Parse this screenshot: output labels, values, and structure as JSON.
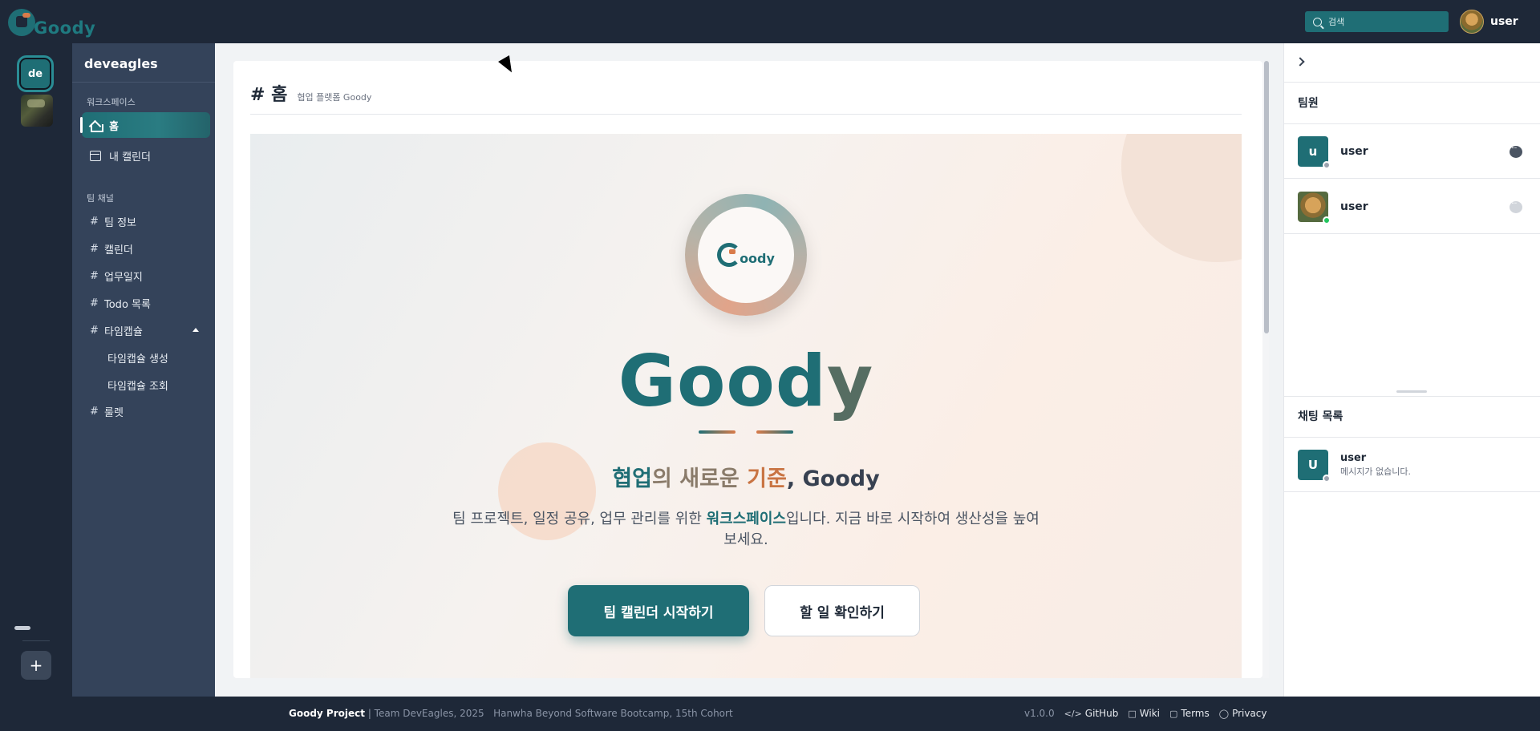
{
  "app": {
    "logo_text": "Goody",
    "search_placeholder": "검색",
    "user_name": "user"
  },
  "rail": {
    "active_workspace_label": "de",
    "add_label": "+"
  },
  "sidebar": {
    "workspace_name": "deveagles",
    "workspace_section_label": "워크스페이스",
    "workspace_items": [
      {
        "label": "홈",
        "icon": "home-icon",
        "active": true
      },
      {
        "label": "내 캘린더",
        "icon": "calendar-icon",
        "active": false
      }
    ],
    "team_section_label": "팀 채널",
    "channels": [
      {
        "hash": "#",
        "label": "팀 정보"
      },
      {
        "hash": "#",
        "label": "캘린더"
      },
      {
        "hash": "#",
        "label": "업무일지"
      },
      {
        "hash": "#",
        "label": "Todo 목록"
      },
      {
        "hash": "#",
        "label": "타임캡슐",
        "expanded": true
      },
      {
        "hash": "#",
        "label": "룰렛"
      }
    ],
    "timecapsule_subitems": [
      "타임캡슐 생성",
      "타임캡슐 조회"
    ]
  },
  "main": {
    "page_title": "# 홈",
    "page_subtitle": "협업 플랫폼 Goody",
    "emblem_word": "oody",
    "hero_title_main": "Good",
    "hero_title_end": "y",
    "tagline": {
      "part1": "협업",
      "part2": "의 새로운 ",
      "part3": "기준",
      "part4": ", Goody"
    },
    "description": {
      "before": "팀 프로젝트, 일정 공유, 업무 관리를 위한 ",
      "bold": "워크스페이스",
      "after": "입니다. 지금 바로 시작하여 생산성을 높여보세요."
    },
    "primary_button": "팀 캘린더 시작하기",
    "secondary_button": "할 일 확인하기"
  },
  "right_panel": {
    "members_heading": "팀원",
    "members": [
      {
        "name": "user",
        "avatar_letter": "u",
        "status_color": "#9ca3af"
      },
      {
        "name": "user",
        "avatar_letter": "",
        "status_color": "#22c55e"
      }
    ],
    "chats_heading": "채팅 목록",
    "chats": [
      {
        "name": "user",
        "avatar_letter": "U",
        "preview": "메시지가 없습니다.",
        "status_color": "#9ca3af"
      }
    ]
  },
  "footer": {
    "project": "Goody Project",
    "team": " | Team DevEagles, 2025",
    "bootcamp": "Hanwha Beyond Software Bootcamp, 15th Cohort",
    "version": "v1.0.0",
    "links": [
      "GitHub",
      "Wiki",
      "Terms",
      "Privacy"
    ]
  },
  "colors": {
    "brand": "#1f6e75",
    "accent": "#d97b4a",
    "dark_bg": "#1e2838",
    "sidebar_bg": "#34435a"
  }
}
